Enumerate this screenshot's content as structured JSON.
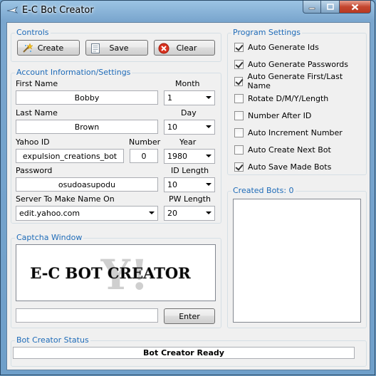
{
  "window": {
    "title": "E-C Bot Creator"
  },
  "controls": {
    "title": "Controls",
    "create_label": "Create",
    "save_label": "Save",
    "clear_label": "Clear"
  },
  "account": {
    "title": "Account Information/Settings",
    "first_name_label": "First Name",
    "first_name": "Bobby",
    "month_label": "Month",
    "month": "1",
    "last_name_label": "Last Name",
    "last_name": "Brown",
    "day_label": "Day",
    "day": "10",
    "yahoo_id_label": "Yahoo ID",
    "yahoo_id": "expulsion_creations_bot",
    "number_label": "Number",
    "number": "0",
    "year_label": "Year",
    "year": "1980",
    "password_label": "Password",
    "password": "osudoasupodu",
    "id_length_label": "ID Length",
    "id_length": "10",
    "server_label": "Server To Make Name On",
    "server": "edit.yahoo.com",
    "pw_length_label": "PW Length",
    "pw_length": "20"
  },
  "captcha": {
    "title": "Captcha Window",
    "image_text": "E-C BOT CREATOR",
    "enter_label": "Enter"
  },
  "program_settings": {
    "title": "Program Settings",
    "options": [
      {
        "label": "Auto Generate Ids",
        "checked": true
      },
      {
        "label": "Auto Generate Passwords",
        "checked": true
      },
      {
        "label": "Auto Generate First/Last Name",
        "checked": true
      },
      {
        "label": "Rotate D/M/Y/Length",
        "checked": false
      },
      {
        "label": "Number After ID",
        "checked": false
      },
      {
        "label": "Auto Increment Number",
        "checked": false
      },
      {
        "label": "Auto Create Next Bot",
        "checked": false
      },
      {
        "label": "Auto Save Made Bots",
        "checked": true
      }
    ]
  },
  "created_bots": {
    "title": "Created Bots: 0"
  },
  "status": {
    "title": "Bot Creator Status",
    "text": "Bot Creator Ready"
  }
}
